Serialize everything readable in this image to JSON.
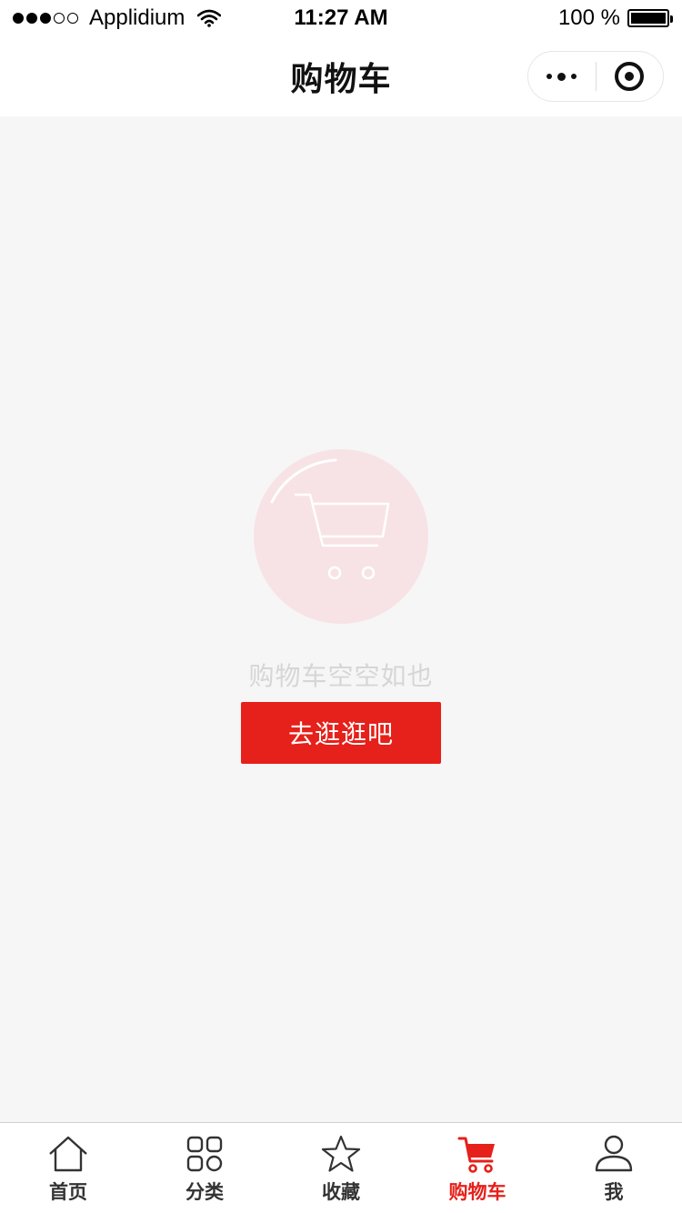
{
  "status_bar": {
    "carrier": "Applidium",
    "time": "11:27 AM",
    "battery": "100 %",
    "battery_level": 1.0,
    "signal_bars_filled": 3,
    "signal_bars_total": 5
  },
  "nav": {
    "title": "购物车",
    "more_icon": "more-dots-icon",
    "close_icon": "record-circle-icon"
  },
  "empty_state": {
    "icon": "shopping-cart-icon",
    "message": "购物车空空如也",
    "button_label": "去逛逛吧"
  },
  "tabs": [
    {
      "label": "首页",
      "icon": "home-icon",
      "active": false
    },
    {
      "label": "分类",
      "icon": "category-grid-icon",
      "active": false
    },
    {
      "label": "收藏",
      "icon": "star-icon",
      "active": false
    },
    {
      "label": "购物车",
      "icon": "cart-icon",
      "active": true
    },
    {
      "label": "我",
      "icon": "user-icon",
      "active": false
    }
  ],
  "colors": {
    "accent": "#e6201a",
    "background": "#f6f6f6",
    "cart_circle": "#f7e3e5",
    "empty_text": "#d6d6d6"
  }
}
